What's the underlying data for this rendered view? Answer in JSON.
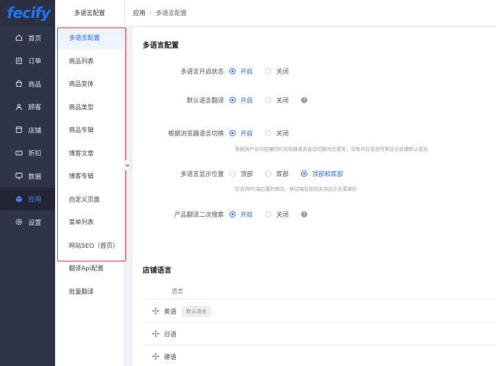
{
  "app": {
    "logo": "fecify"
  },
  "nav": {
    "items": [
      {
        "label": "首页",
        "icon": "home-icon"
      },
      {
        "label": "订单",
        "icon": "order-icon"
      },
      {
        "label": "商品",
        "icon": "bag-icon"
      },
      {
        "label": "顾客",
        "icon": "user-icon"
      },
      {
        "label": "店铺",
        "icon": "store-icon"
      },
      {
        "label": "折扣",
        "icon": "ticket-icon"
      },
      {
        "label": "数据",
        "icon": "monitor-icon"
      },
      {
        "label": "应用",
        "icon": "cube-icon",
        "active": true
      },
      {
        "label": "设置",
        "icon": "gear-icon"
      }
    ]
  },
  "subnav": {
    "title": "多语言配置",
    "items": [
      {
        "label": "多语言配置",
        "active": true
      },
      {
        "label": "商品列表"
      },
      {
        "label": "商品变体"
      },
      {
        "label": "商品类型"
      },
      {
        "label": "商品专辑"
      },
      {
        "label": "博客文章"
      },
      {
        "label": "博客专辑"
      },
      {
        "label": "自定义页面"
      },
      {
        "label": "菜单列表"
      },
      {
        "label": "网站SEO（首页）"
      },
      {
        "label": "翻译Api配置"
      },
      {
        "label": "批量翻译"
      }
    ]
  },
  "breadcrumb": {
    "level1": "应用",
    "separator": "/",
    "level2": "多语言配置"
  },
  "config": {
    "title": "多语言配置",
    "rows": [
      {
        "label": "多语言开启状态",
        "options": [
          "开启",
          "关闭"
        ],
        "selected": 0
      },
      {
        "label": "默认语言翻译",
        "options": [
          "开启",
          "关闭"
        ],
        "selected": 0,
        "help": "?"
      },
      {
        "label": "根据浏览器语言切换",
        "options": [
          "开启",
          "关闭"
        ],
        "selected": 0,
        "hint": "根据用户访问店铺时的浏览器语言自动切换对应语言，没有对应语言时将显示店铺默认语言"
      },
      {
        "label": "多语言显示位置",
        "options": [
          "顶部",
          "底部",
          "顶部和底部"
        ],
        "selected": 2,
        "hint": "仅支持PC端位置的修改，移动端目前仅支持显示在菜单栏"
      },
      {
        "label": "产品翻译二次搜索",
        "options": [
          "开启",
          "关闭"
        ],
        "selected": 0,
        "help": "?"
      }
    ]
  },
  "store_languages": {
    "title": "店铺语言",
    "column": "语言",
    "rows": [
      {
        "name": "英语",
        "tag": "默认语言"
      },
      {
        "name": "日语"
      },
      {
        "name": "德语"
      }
    ]
  },
  "colors": {
    "accent": "#1e66f5",
    "sidebar": "#2f3447",
    "highlight_box": "#e4393c"
  }
}
